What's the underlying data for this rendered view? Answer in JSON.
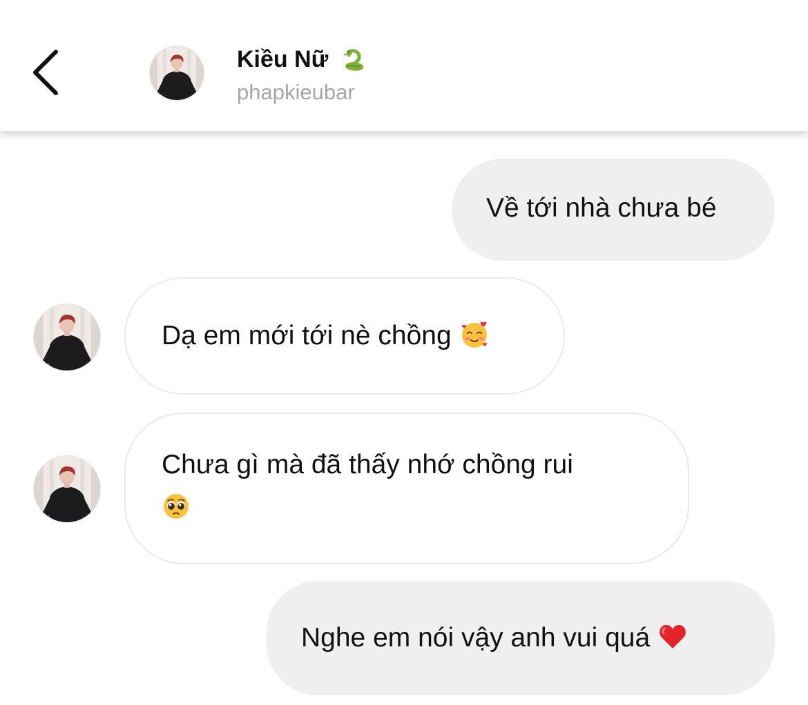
{
  "header": {
    "title": "Kiều Nữ",
    "title_emoji_icon": "snake-emoji",
    "username": "phapkieubar"
  },
  "messages": [
    {
      "direction": "sent",
      "text": "Về tới nhà chưa bé"
    },
    {
      "direction": "received",
      "text": "Dạ em mới tới nè chồng",
      "emoji_icon": "smiling-face-with-hearts-emoji"
    },
    {
      "direction": "received",
      "text": "Chưa gì mà đã thấy nhớ chồng rui",
      "emoji_icon": "pleading-face-emoji"
    },
    {
      "direction": "sent",
      "text": "Nghe em nói vậy anh vui quá",
      "emoji_icon": "red-heart-emoji"
    }
  ],
  "colors": {
    "sent_bubble": "#efefef",
    "received_bubble_border": "#ebebeb",
    "username_gray": "#a7a7a7",
    "text": "#111111"
  }
}
